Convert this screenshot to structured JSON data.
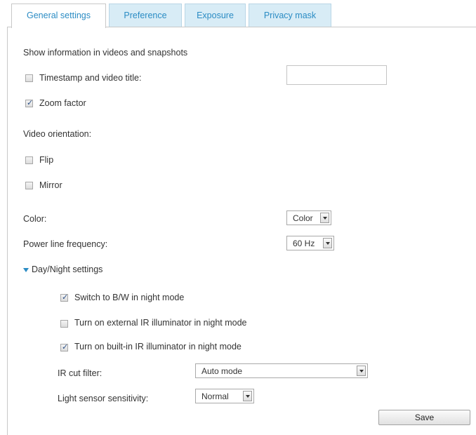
{
  "tabs": [
    "General settings",
    "Preference",
    "Exposure",
    "Privacy mask"
  ],
  "show_info": {
    "heading": "Show information in videos and snapshots",
    "timestamp_label": "Timestamp and video title:",
    "timestamp_checked": false,
    "title_value": "",
    "zoom_label": "Zoom factor",
    "zoom_checked": true
  },
  "orientation": {
    "heading": "Video orientation:",
    "flip_label": "Flip",
    "flip_checked": false,
    "mirror_label": "Mirror",
    "mirror_checked": false
  },
  "color": {
    "label": "Color:",
    "value": "Color"
  },
  "power": {
    "label": "Power line frequency:",
    "value": "60 Hz"
  },
  "daynight": {
    "heading": "Day/Night settings",
    "bw_label": "Switch to B/W in night mode",
    "bw_checked": true,
    "external_ir_label": "Turn on external IR illuminator in night mode",
    "external_ir_checked": false,
    "builtin_ir_label": "Turn on built-in IR illuminator in night mode",
    "builtin_ir_checked": true,
    "ir_cut_label": "IR cut filter:",
    "ir_cut_value": "Auto mode",
    "light_sensor_label": "Light sensor sensitivity:",
    "light_sensor_value": "Normal"
  },
  "save_label": "Save",
  "colors": {
    "tab_text": "#2b8cc4",
    "tab_bg": "#d8ecf6",
    "border": "#c8c8c8"
  }
}
